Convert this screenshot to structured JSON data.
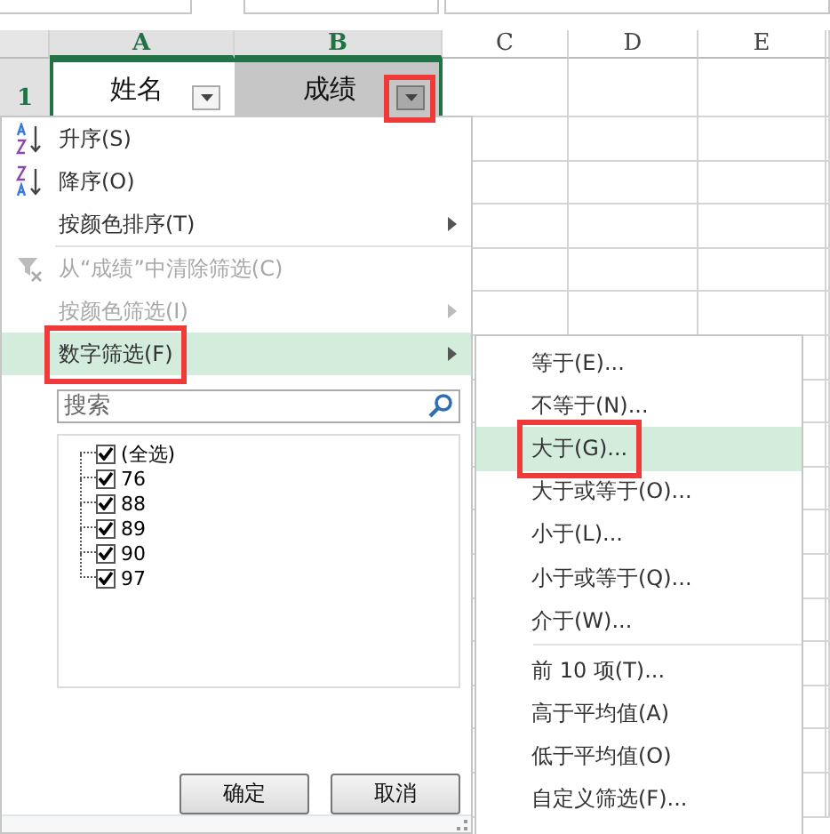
{
  "columns": [
    {
      "label": "A",
      "selected": true
    },
    {
      "label": "B",
      "selected": true
    },
    {
      "label": "C",
      "selected": false
    },
    {
      "label": "D",
      "selected": false
    },
    {
      "label": "E",
      "selected": false
    }
  ],
  "row_header": {
    "label": "1",
    "selected": true
  },
  "header_cells": [
    {
      "text": "姓名",
      "selected": false,
      "annotated": false
    },
    {
      "text": "成绩",
      "selected": true,
      "annotated": true
    }
  ],
  "filter_menu": {
    "items": [
      {
        "kind": "sort-asc",
        "label": "升序(S)",
        "disabled": false,
        "submenu": false,
        "selected": false,
        "annotated": false
      },
      {
        "kind": "sort-desc",
        "label": "降序(O)",
        "disabled": false,
        "submenu": false,
        "selected": false,
        "annotated": false
      },
      {
        "kind": "plain",
        "label": "按颜色排序(T)",
        "disabled": false,
        "submenu": true,
        "selected": false,
        "annotated": false
      },
      {
        "kind": "divider"
      },
      {
        "kind": "clear-filter",
        "label": "从“成绩”中清除筛选(C)",
        "disabled": true,
        "submenu": false,
        "selected": false,
        "annotated": false
      },
      {
        "kind": "plain",
        "label": "按颜色筛选(I)",
        "disabled": true,
        "submenu": true,
        "selected": false,
        "annotated": false
      },
      {
        "kind": "plain",
        "label": "数字筛选(F)",
        "disabled": false,
        "submenu": true,
        "selected": true,
        "annotated": true
      }
    ],
    "search": {
      "placeholder": "搜索"
    },
    "values": [
      {
        "label": "(全选)",
        "checked": true
      },
      {
        "label": "76",
        "checked": true
      },
      {
        "label": "88",
        "checked": true
      },
      {
        "label": "89",
        "checked": true
      },
      {
        "label": "90",
        "checked": true
      },
      {
        "label": "97",
        "checked": true
      }
    ],
    "buttons": [
      "确定",
      "取消"
    ]
  },
  "number_filter_menu": {
    "items": [
      {
        "kind": "item",
        "label": "等于(E)...",
        "selected": false,
        "annotated": false
      },
      {
        "kind": "item",
        "label": "不等于(N)...",
        "selected": false,
        "annotated": false
      },
      {
        "kind": "item",
        "label": "大于(G)...",
        "selected": true,
        "annotated": true
      },
      {
        "kind": "item",
        "label": "大于或等于(O)...",
        "selected": false,
        "annotated": false
      },
      {
        "kind": "item",
        "label": "小于(L)...",
        "selected": false,
        "annotated": false
      },
      {
        "kind": "item",
        "label": "小于或等于(Q)...",
        "selected": false,
        "annotated": false
      },
      {
        "kind": "item",
        "label": "介于(W)...",
        "selected": false,
        "annotated": false
      },
      {
        "kind": "divider"
      },
      {
        "kind": "item",
        "label": "前 10 项(T)...",
        "selected": false,
        "annotated": false
      },
      {
        "kind": "item",
        "label": "高于平均值(A)",
        "selected": false,
        "annotated": false
      },
      {
        "kind": "item",
        "label": "低于平均值(O)",
        "selected": false,
        "annotated": false
      },
      {
        "kind": "item",
        "label": "自定义筛选(F)...",
        "selected": false,
        "annotated": false
      }
    ]
  }
}
